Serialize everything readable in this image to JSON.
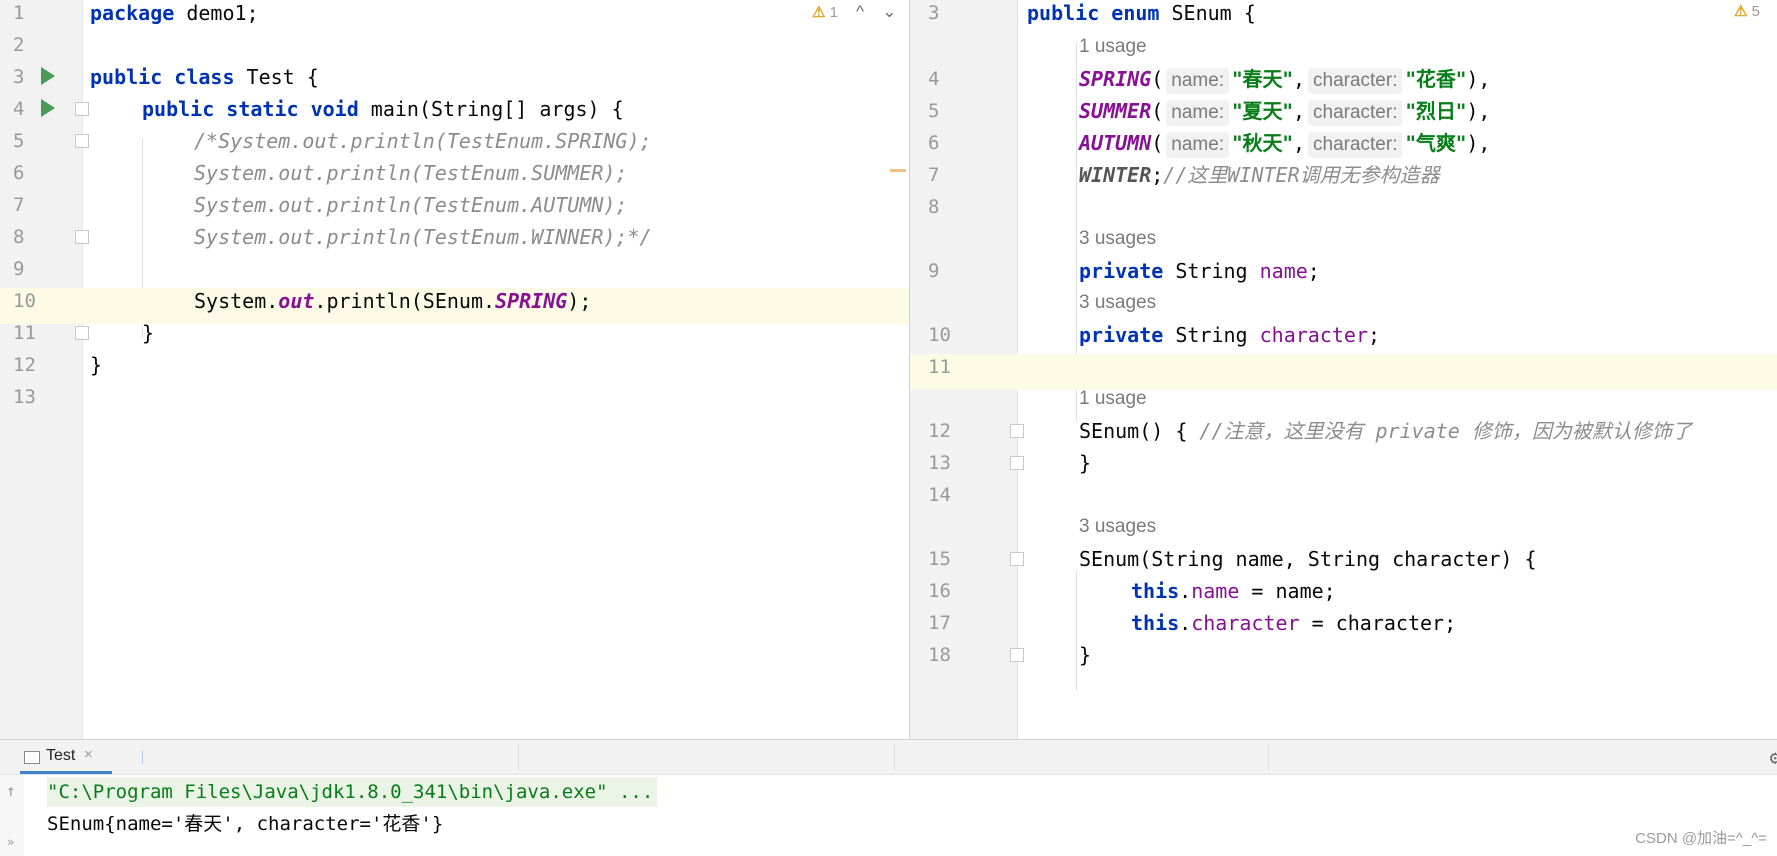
{
  "left_editor": {
    "inspection": {
      "warning_count": "1",
      "prev_glyph": "^",
      "next_glyph": "⌄"
    },
    "line_numbers": [
      "1",
      "2",
      "3",
      "4",
      "5",
      "6",
      "7",
      "8",
      "9",
      "10",
      "11",
      "12",
      "13"
    ],
    "code": {
      "l1_kw": "package",
      "l1_rest": " demo1;",
      "l3_kw1": "public",
      "l3_kw2": "class",
      "l3_rest": " Test {",
      "l4_kw1": "public",
      "l4_kw2": "static",
      "l4_kw3": "void",
      "l4_rest": " main(String[] args) {",
      "l5": "/*System.out.println(TestEnum.SPRING);",
      "l6": "System.out.println(TestEnum.SUMMER);",
      "l7": "System.out.println(TestEnum.AUTUMN);",
      "l8": "System.out.println(TestEnum.WINNER);*/",
      "l10_a": "System.",
      "l10_out": "out",
      "l10_b": ".println(SEnum.",
      "l10_spring": "SPRING",
      "l10_c": ");",
      "l11": "}",
      "l12": "}"
    }
  },
  "right_editor": {
    "inspection": {
      "warning_count": "5"
    },
    "line_numbers": [
      "3",
      "4",
      "5",
      "6",
      "7",
      "8",
      "9",
      "10",
      "11",
      "12",
      "13",
      "14",
      "15",
      "16",
      "17",
      "18"
    ],
    "usages": {
      "u1": "1 usage",
      "u2": "3 usages",
      "u3": "3 usages",
      "u4": "1 usage",
      "u5": "3 usages"
    },
    "code": {
      "l3_kw1": "public",
      "l3_kw2": "enum",
      "l3_rest": " SEnum {",
      "hint_name": "name:",
      "hint_character": "character:",
      "l4_const": "SPRING",
      "l4_s1": "\"春天\"",
      "l4_s2": "\"花香\"",
      "l5_const": "SUMMER",
      "l5_s1": "\"夏天\"",
      "l5_s2": "\"烈日\"",
      "l6_const": "AUTUMN",
      "l6_s1": "\"秋天\"",
      "l6_s2": "\"气爽\"",
      "paren_open": "(",
      "comma": ",",
      "close_comma": "),",
      "l7_const": "WINTER",
      "l7_semi": ";",
      "l7_comment": "//这里WINTER调用无参构造器",
      "l9_kw": "private",
      "l9_type": " String ",
      "l9_field": "name",
      "l9_semi": ";",
      "l10_kw": "private",
      "l10_type": " String ",
      "l10_field": "character",
      "l10_semi": ";",
      "l12_code": "SEnum() { ",
      "l12_comment": "//注意，这里没有 private 修饰，因为被默认修饰了",
      "l13": "}",
      "l15": "SEnum(String name, String character) {",
      "l16_kw": "this",
      "l16_dot": ".",
      "l16_field": "name",
      "l16_rest": " = name;",
      "l17_kw": "this",
      "l17_dot": ".",
      "l17_field": "character",
      "l17_rest": " = character;",
      "l18": "}"
    }
  },
  "run_panel": {
    "tab_label": "Test",
    "tab_close": "×",
    "console": {
      "cmd": "\"C:\\Program Files\\Java\\jdk1.8.0_341\\bin\\java.exe\" ...",
      "output": "SEnum{name='春天', character='花香'}"
    },
    "watermark": "CSDN @加油=^_^="
  },
  "icons": {
    "run": "run-gutter-icon",
    "fold": "fold-marker-icon",
    "warning": "warning-triangle-icon",
    "settings": "gear-icon",
    "up": "up-arrow-icon",
    "more": "double-chevron-icon",
    "tab": "run-tab-icon"
  },
  "colors": {
    "keyword": "#0033b3",
    "enum_constant": "#871094",
    "string": "#067d17",
    "comment": "#8c8c8c",
    "current_line": "#fdfbe6",
    "run_icon": "#499c54",
    "warning": "#e3a21a"
  }
}
